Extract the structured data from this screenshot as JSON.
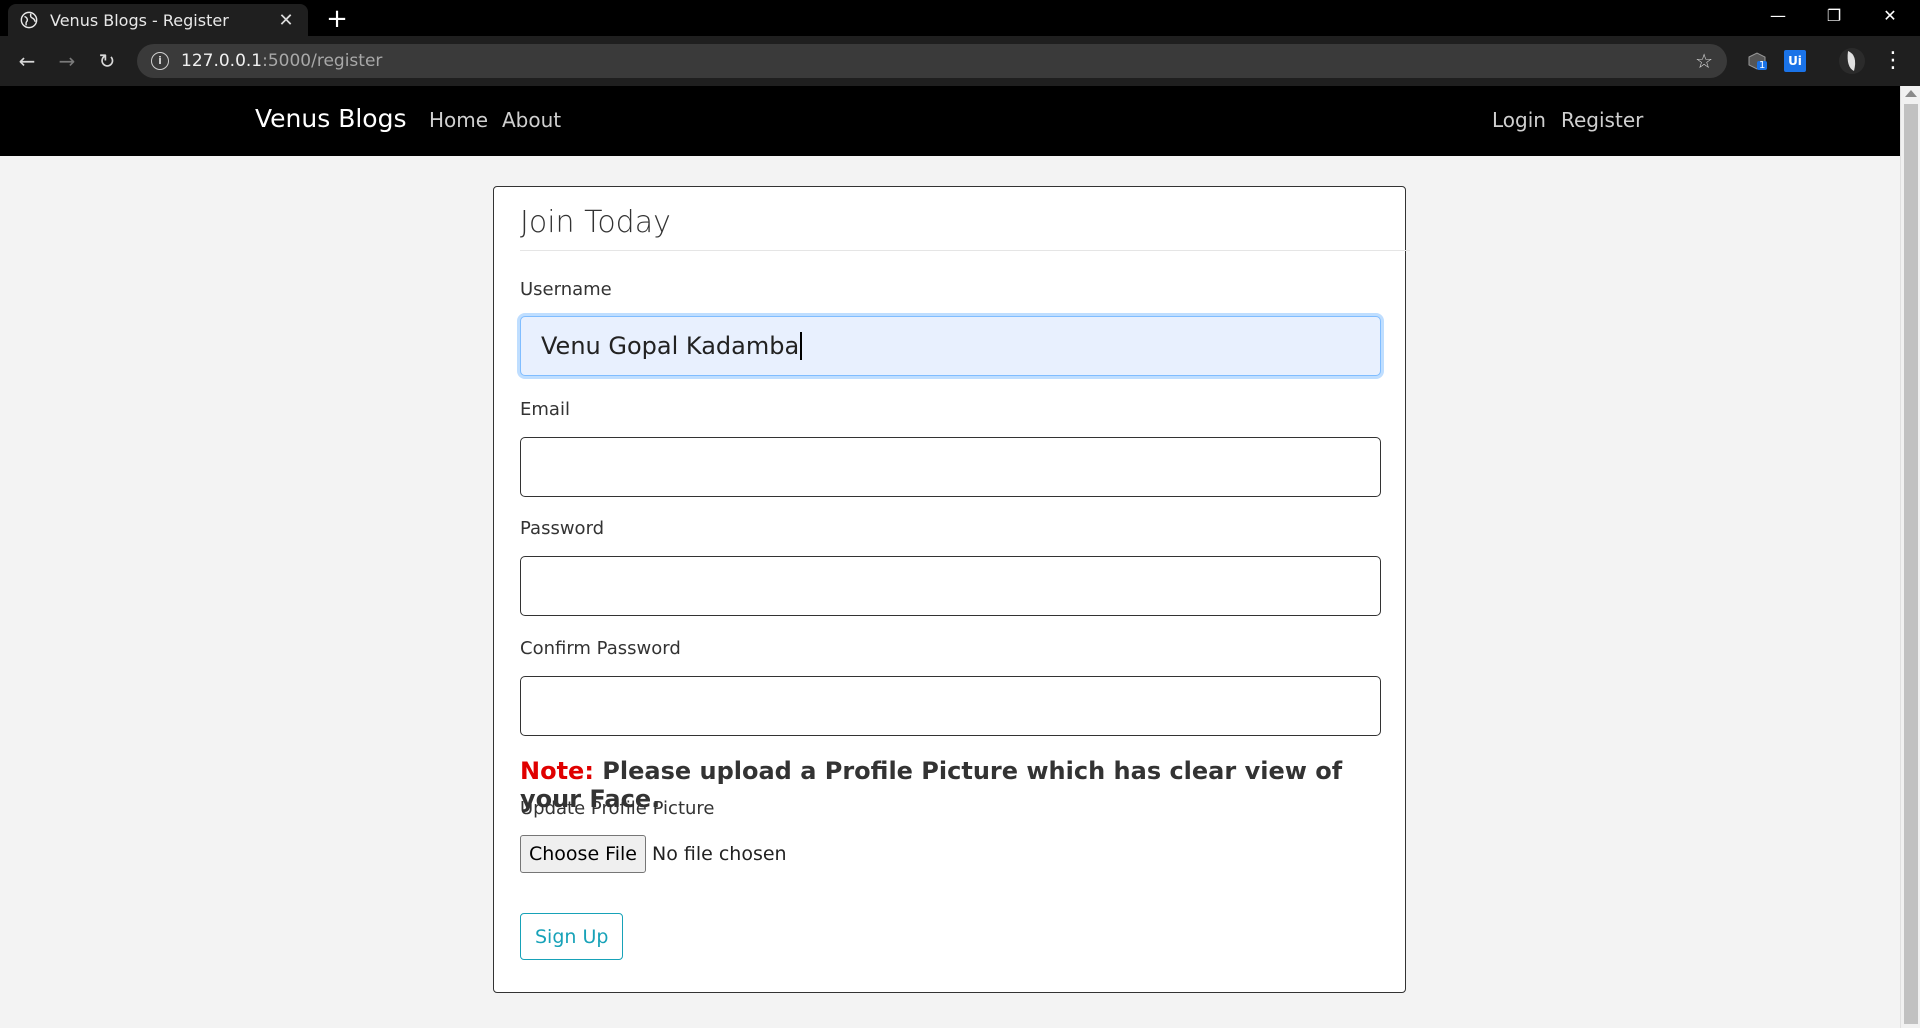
{
  "browser": {
    "tab_title": "Venus Blogs - Register",
    "tab_close": "✕",
    "new_tab": "+",
    "url_host": "127.0.0.1",
    "url_path": ":5000/register",
    "back": "←",
    "forward": "→",
    "reload": "↻",
    "star": "☆",
    "minimize": "—",
    "restore": "❐",
    "close": "✕",
    "ext_ui_label": "Ui",
    "ext_badge": "1",
    "menu": "⋮"
  },
  "site_nav": {
    "brand": "Venus Blogs",
    "links": [
      "Home",
      "About"
    ],
    "right_links": [
      "Login",
      "Register"
    ]
  },
  "form": {
    "legend": "Join Today",
    "username_label": "Username",
    "username_value": "Venu Gopal Kadamba",
    "email_label": "Email",
    "password_label": "Password",
    "confirm_label": "Confirm Password",
    "note_key": "Note:",
    "note_text": " Please upload a Profile Picture which has clear view of your Face.",
    "picture_label": "Update Profile Picture",
    "choose_file": "Choose File",
    "file_status": "No file chosen",
    "submit": "Sign Up"
  },
  "colors": {
    "nav_bg": "#000000",
    "note_red": "#e00000",
    "signup_teal": "#17a2b8",
    "focus_bg": "#e8f0fe"
  }
}
